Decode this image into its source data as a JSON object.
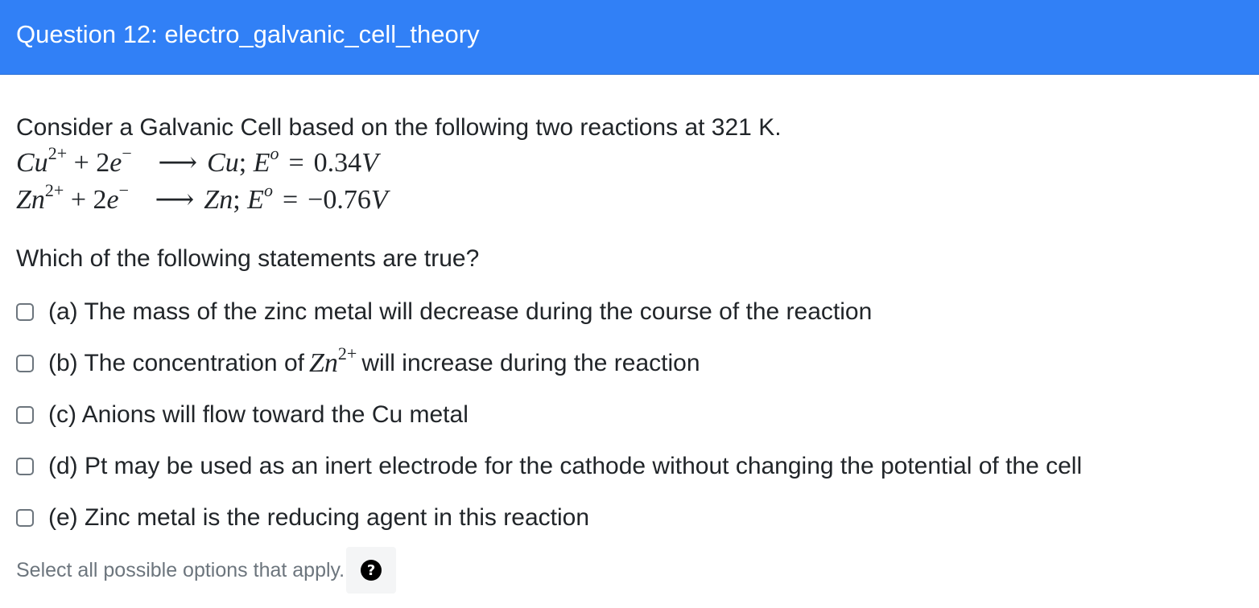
{
  "header": {
    "title": "Question 12: electro_galvanic_cell_theory"
  },
  "question": {
    "intro": "Consider a Galvanic Cell based on the following two reactions at 321 K.",
    "reactions": [
      {
        "reactant_ion": "Cu",
        "charge": "2+",
        "plus_electrons": "+ 2",
        "electron": "e",
        "electron_charge": "−",
        "arrow": "⟶",
        "product": "Cu",
        "sep": ";",
        "potential_symbol": "E",
        "potential_sup": "o",
        "equals": "=",
        "potential_value": "0.34",
        "unit": "V"
      },
      {
        "reactant_ion": "Zn",
        "charge": "2+",
        "plus_electrons": "+ 2",
        "electron": "e",
        "electron_charge": "−",
        "arrow": "⟶",
        "product": "Zn",
        "sep": ";",
        "potential_symbol": "E",
        "potential_sup": "o",
        "equals": "=",
        "potential_value": "−0.76",
        "unit": "V"
      }
    ],
    "prompt": "Which of the following statements are true?"
  },
  "options": [
    {
      "text": "(a) The mass of the zinc metal will decrease during the course of the reaction",
      "checked": false
    },
    {
      "text_before": "(b) The concentration of",
      "math_var": "Zn",
      "math_sup": "2+",
      "text_after": "will increase during the reaction",
      "checked": false
    },
    {
      "text": "(c) Anions will flow toward the Cu metal",
      "checked": false
    },
    {
      "text": "(d) Pt may be used as an inert electrode for the cathode without changing the potential of the cell",
      "checked": false
    },
    {
      "text": "(e) Zinc metal is the reducing agent in this reaction",
      "checked": false
    }
  ],
  "footer": {
    "hint": "Select all possible options that apply.",
    "help_icon": "question-circle-icon",
    "help_glyph": "?"
  },
  "colors": {
    "header_bg": "#3180f6",
    "header_text": "#ffffff",
    "hint_text": "#6c757d"
  }
}
